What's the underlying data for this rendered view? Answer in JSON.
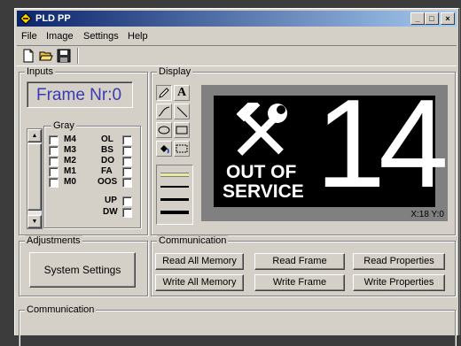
{
  "window": {
    "title": "PLD PP",
    "minimize_label": "_",
    "maximize_label": "□",
    "close_label": "×"
  },
  "menu": [
    "File",
    "Image",
    "Settings",
    "Help"
  ],
  "toolbar": [
    "new-file",
    "open-folder",
    "save-disk"
  ],
  "inputs": {
    "group_label": "Inputs",
    "frame_label": "Frame Nr:0",
    "gray_label": "Gray",
    "gray_bits": [
      "M4",
      "M3",
      "M2",
      "M1",
      "M0"
    ],
    "flags": [
      "OL",
      "BS",
      "DO",
      "FA",
      "OOS"
    ],
    "up_label": "UP",
    "dw_label": "DW"
  },
  "display": {
    "group_label": "Display",
    "tools": [
      "pencil-icon",
      "text-icon",
      "curve-icon",
      "line-icon",
      "ellipse-icon",
      "rectangle-icon",
      "fill-icon",
      "select-icon"
    ],
    "text_tool": "A",
    "line_widths": [
      1,
      2,
      3,
      4
    ],
    "sign": {
      "text_line1": "OUT OF",
      "text_line2": "SERVICE",
      "number": "14"
    },
    "coords": "X:18 Y:0",
    "colors": {
      "screen": "#000000",
      "frame": "#808080",
      "line_swatch": "#e8e8a0"
    }
  },
  "adjustments": {
    "group_label": "Adjustments",
    "system_settings": "System Settings"
  },
  "communication": {
    "group_label": "Communication",
    "read_all": "Read All Memory",
    "read_frame": "Read Frame",
    "read_props": "Read Properties",
    "write_all": "Write All Memory",
    "write_frame": "Write Frame",
    "write_props": "Write Properties"
  },
  "log": {
    "group_label": "Communication"
  }
}
